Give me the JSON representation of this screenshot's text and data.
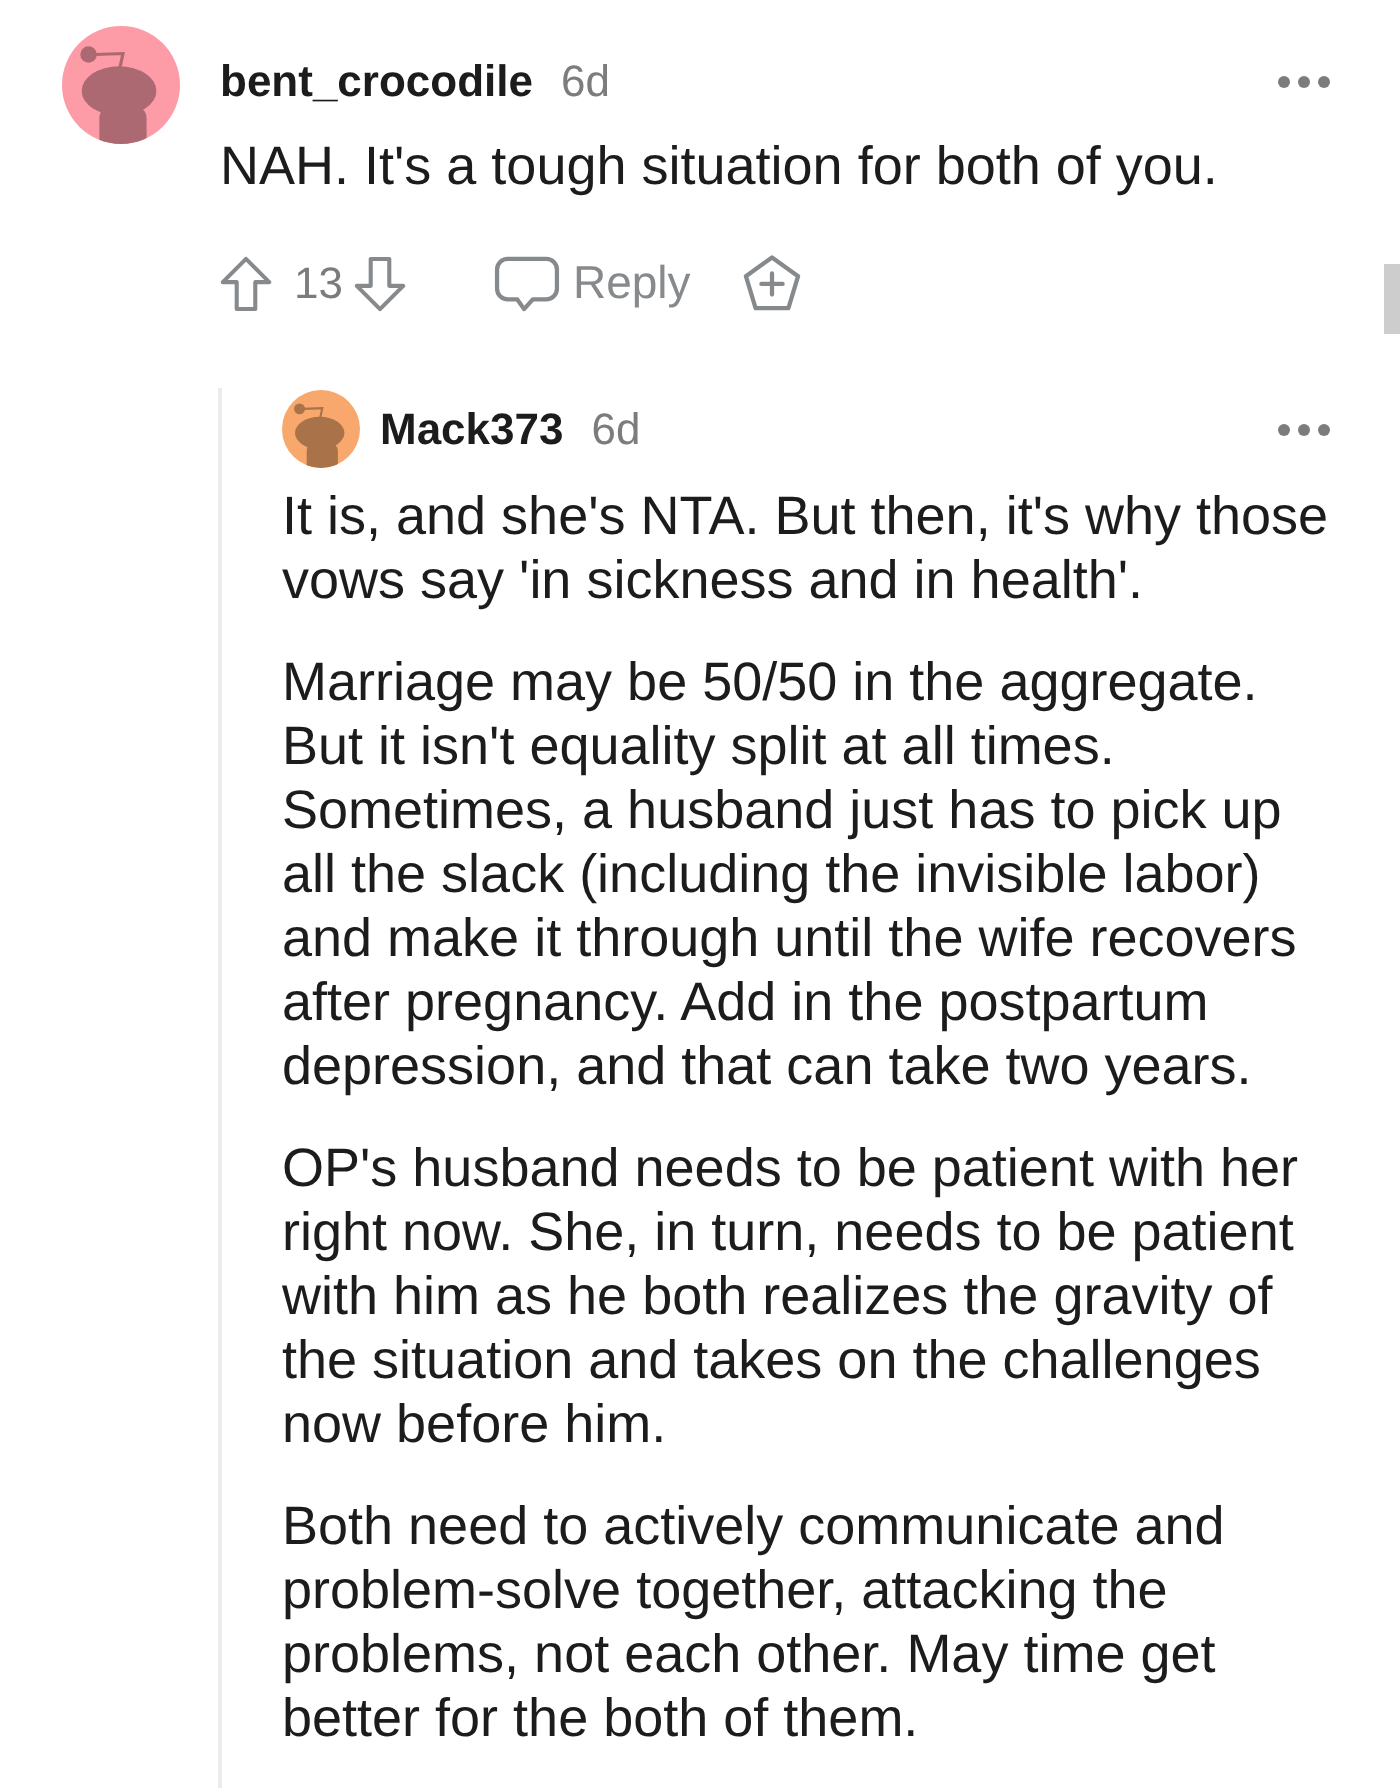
{
  "comments": [
    {
      "author": "bent_crocodile",
      "age": "6d",
      "color": "#fd9ba6",
      "body": [
        "NAH. It's a tough situation for both of you."
      ],
      "votes": "13",
      "reply_label": "Reply",
      "replies": [
        {
          "author": "Mack373",
          "age": "6d",
          "color": "#f8a86c",
          "body": [
            "It is, and she's NTA. But then, it's why those vows say 'in sickness and in health'.",
            "Marriage may be 50/50 in the aggregate. But it isn't equality split at all times. Sometimes, a husband just has to pick up all the slack (including the invisible labor) and make it through until the wife recovers after pregnancy. Add in the postpartum depression, and that can take two years.",
            "OP's husband needs to be patient with her right now. She, in turn, needs to be patient with him as he both realizes the gravity of the situation and takes on the challenges now before him.",
            "Both need to actively communicate and problem-solve together, attacking the problems, not each other. May time get better for the both of them."
          ]
        }
      ]
    }
  ]
}
